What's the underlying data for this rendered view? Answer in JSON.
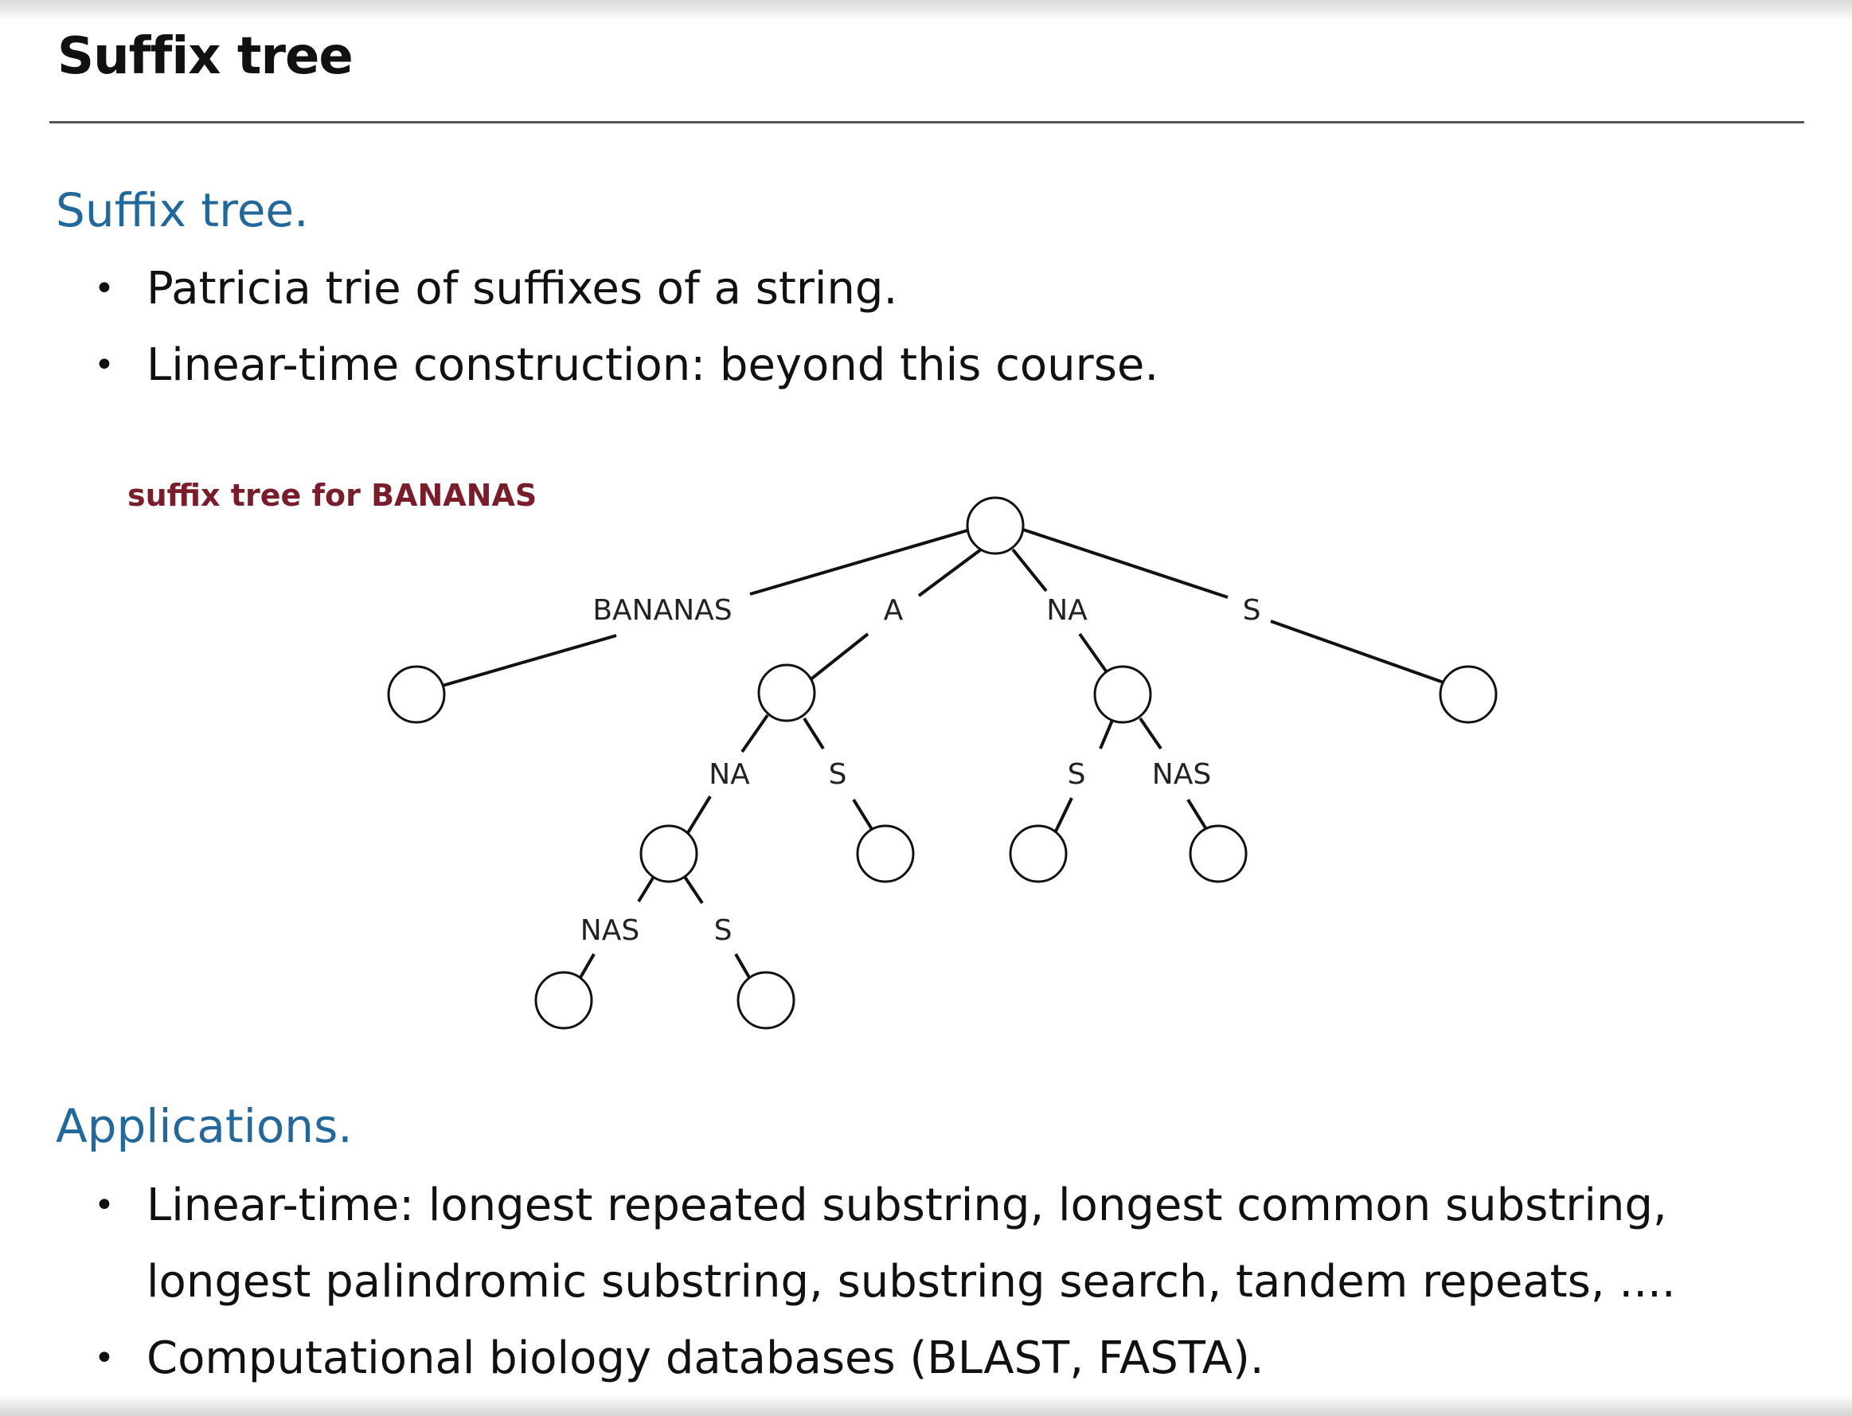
{
  "slide": {
    "title": "Suffix tree"
  },
  "intro": {
    "heading": "Suffix tree.",
    "bullets": [
      "Patricia trie of suffixes of a string.",
      "Linear-time construction:  beyond this course."
    ]
  },
  "diagram": {
    "caption": "suffix tree for BANANAS",
    "edge_labels": {
      "root_left": "BANANAS",
      "root_a": "A",
      "root_na": "NA",
      "root_s": "S",
      "a_na": "NA",
      "a_s": "S",
      "na_s": "S",
      "na_nas": "NAS",
      "ana_nas": "NAS",
      "ana_s": "S"
    }
  },
  "applications": {
    "heading": "Applications.",
    "bullets": [
      "Linear-time: longest repeated substring, longest common substring,",
      "longest palindromic substring, substring search, tandem repeats, ....",
      "Computational biology databases (BLAST, FASTA)."
    ]
  },
  "colors": {
    "heading": "#23689b",
    "caption": "#7a1d2a",
    "text": "#111111"
  }
}
